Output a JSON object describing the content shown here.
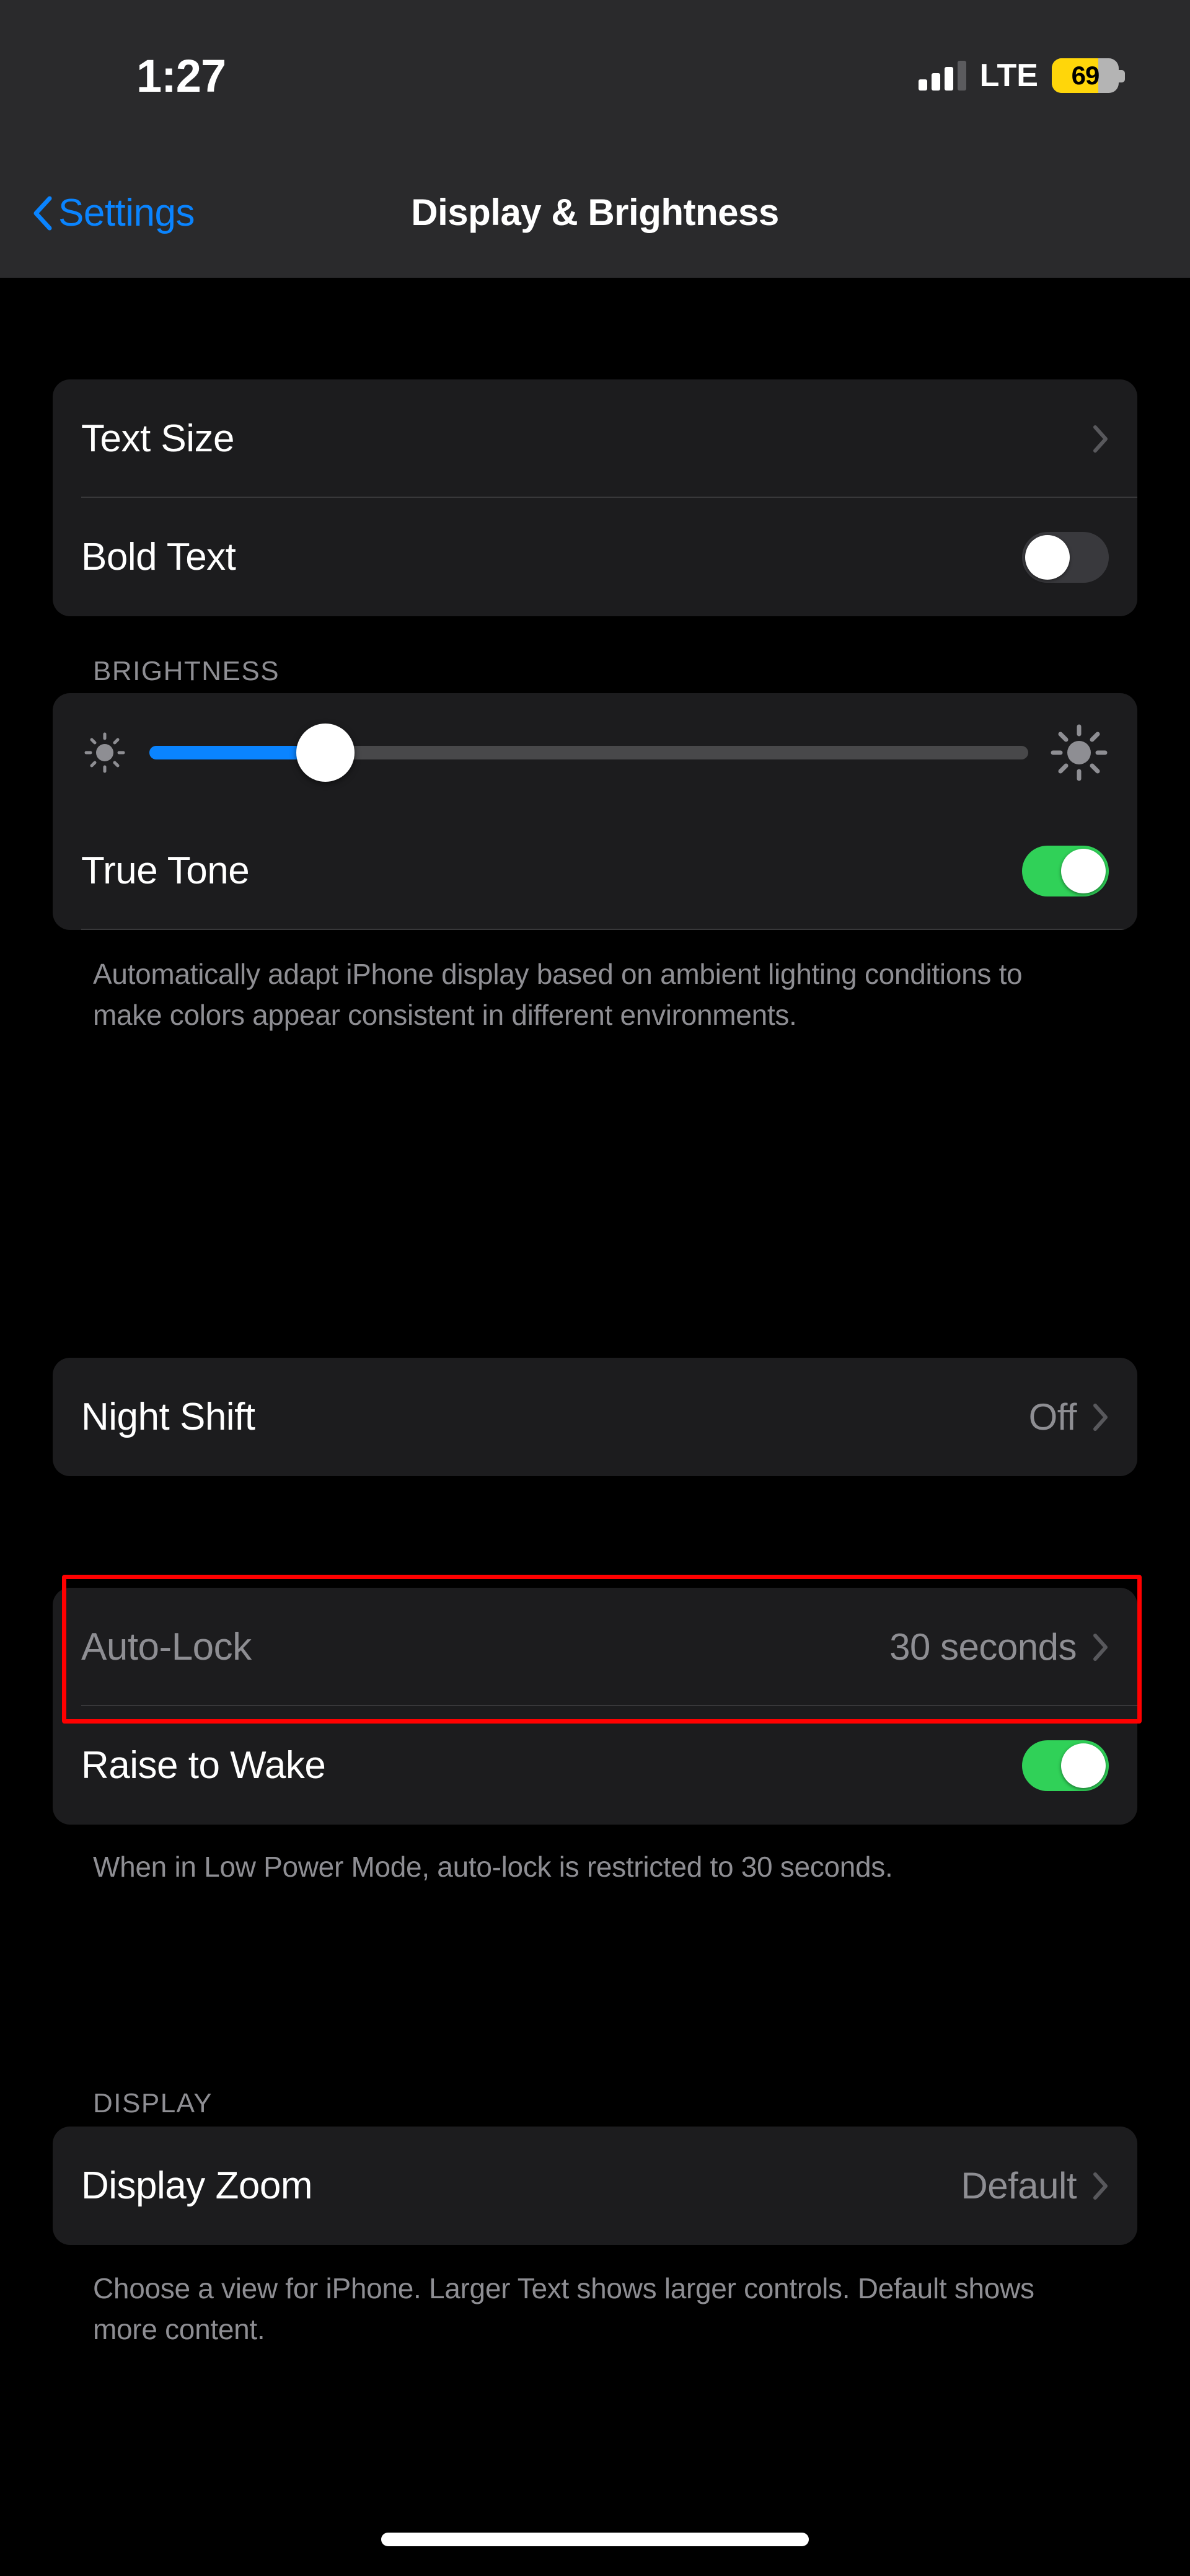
{
  "status_bar": {
    "time": "1:27",
    "network_label": "LTE",
    "battery_percent": "69",
    "battery_level": 69,
    "battery_color": "#ffd60a",
    "signal_bars_filled": 3,
    "signal_bars_total": 4
  },
  "nav": {
    "back_label": "Settings",
    "title": "Display & Brightness"
  },
  "groups": {
    "text": {
      "rows": [
        {
          "label": "Text Size",
          "type": "disclosure",
          "value": ""
        },
        {
          "label": "Bold Text",
          "type": "toggle",
          "state": "off"
        }
      ]
    },
    "brightness": {
      "header": "BRIGHTNESS",
      "slider": {
        "name": "brightness-slider",
        "value": 20,
        "min": 0,
        "max": 100
      },
      "true_tone": {
        "label": "True Tone",
        "type": "toggle",
        "state": "on"
      },
      "footer": "Automatically adapt iPhone display based on ambient lighting conditions to make colors appear consistent in different environments."
    },
    "night_shift": {
      "rows": [
        {
          "label": "Night Shift",
          "type": "disclosure",
          "value": "Off"
        }
      ]
    },
    "lock": {
      "rows": [
        {
          "label": "Auto-Lock",
          "type": "disclosure",
          "value": "30 seconds",
          "disabled": true,
          "highlighted": true
        },
        {
          "label": "Raise to Wake",
          "type": "toggle",
          "state": "on"
        }
      ],
      "footer": "When in Low Power Mode, auto-lock is restricted to 30 seconds."
    },
    "display": {
      "header": "DISPLAY",
      "rows": [
        {
          "label": "Display Zoom",
          "type": "disclosure",
          "value": "Default"
        }
      ],
      "footer": "Choose a view for iPhone. Larger Text shows larger controls. Default shows more content."
    }
  },
  "colors": {
    "accent_blue": "#0a84ff",
    "toggle_on_green": "#30d158",
    "toggle_off_grey": "#39393d",
    "card_background": "#1c1c1e",
    "page_background": "#000000",
    "secondary_text": "#8e8e93",
    "highlight_red": "#ff0000"
  }
}
